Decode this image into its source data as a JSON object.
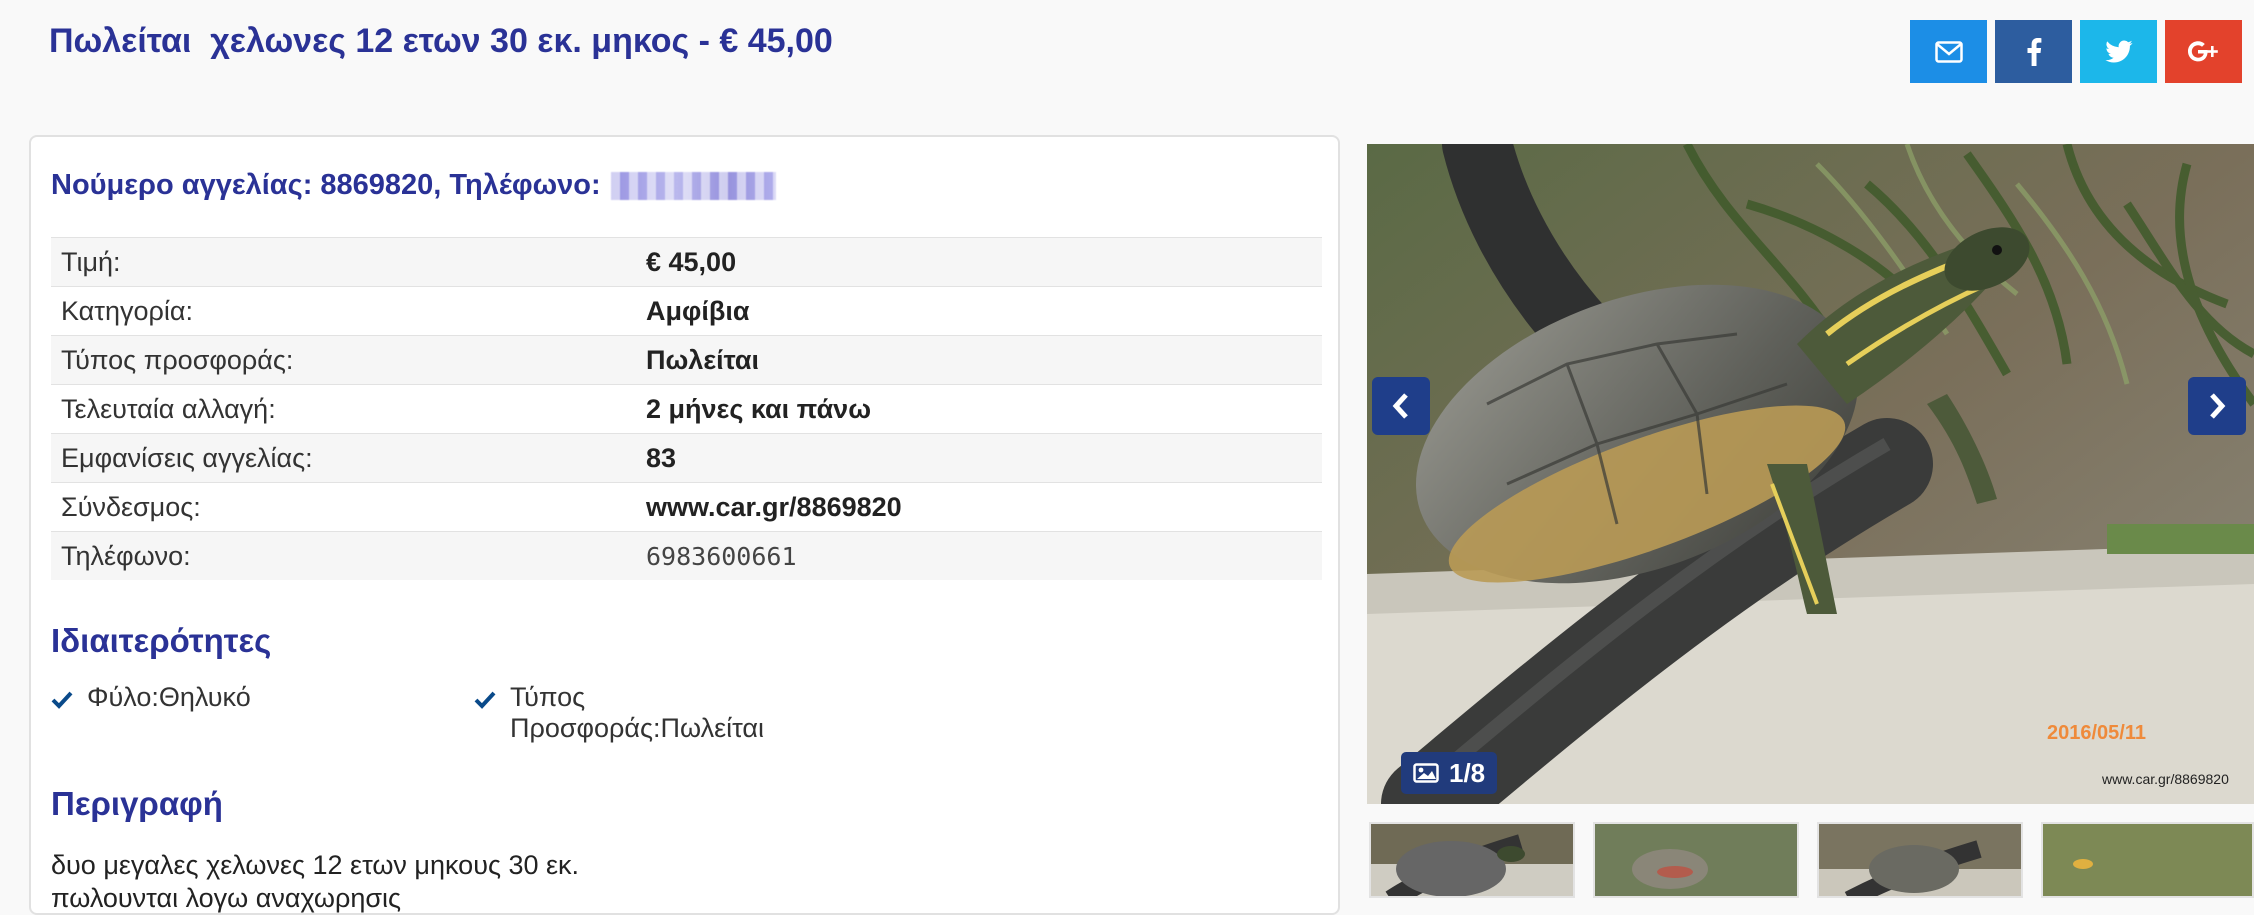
{
  "header": {
    "title": "Πωλείται  χελωνες 12 ετων 30 εκ. μηκος - € 45,00"
  },
  "share": [
    {
      "icon": "envelope-icon",
      "color": "#1c8ee6"
    },
    {
      "icon": "facebook-icon",
      "color": "#2d5d9f"
    },
    {
      "icon": "twitter-icon",
      "color": "#1cb7ea"
    },
    {
      "icon": "google-plus-icon",
      "color": "#e3422c"
    }
  ],
  "listing": {
    "heading": "Νούμερο αγγελίας: 8869820, Τηλέφωνο:",
    "details": [
      {
        "label": "Τιμή:",
        "value": "€ 45,00"
      },
      {
        "label": "Κατηγορία:",
        "value": "Αμφίβια"
      },
      {
        "label": "Τύπος προσφοράς:",
        "value": "Πωλείται"
      },
      {
        "label": "Τελευταία αλλαγή:",
        "value": "2 μήνες και πάνω"
      },
      {
        "label": "Εμφανίσεις αγγελίας:",
        "value": "83"
      },
      {
        "label": "Σύνδεσμος:",
        "value": "www.car.gr/8869820"
      },
      {
        "label": "Τηλέφωνο:",
        "value": "6983600661"
      }
    ]
  },
  "features": {
    "title": "Ιδιαιτερότητες",
    "items": [
      {
        "line1": "Φύλο:Θηλυκό",
        "line2": ""
      },
      {
        "line1": "Τύπος",
        "line2": "Προσφοράς:Πωλείται"
      }
    ]
  },
  "description": {
    "title": "Περιγραφή",
    "line1": "δυο μεγαλες χελωνες 12 ετων μηκους 30 εκ.",
    "line2": "πωλουνται λογω αναχωρησις"
  },
  "gallery": {
    "counter": "1/8",
    "date_stamp": "2016/05/11",
    "watermark": "www.car.gr/8869820",
    "thumbnail_count": 4
  },
  "colors": {
    "title": "#2a3296",
    "gallery_nav": "#1f3e8a",
    "check": "#0a4a8a"
  }
}
